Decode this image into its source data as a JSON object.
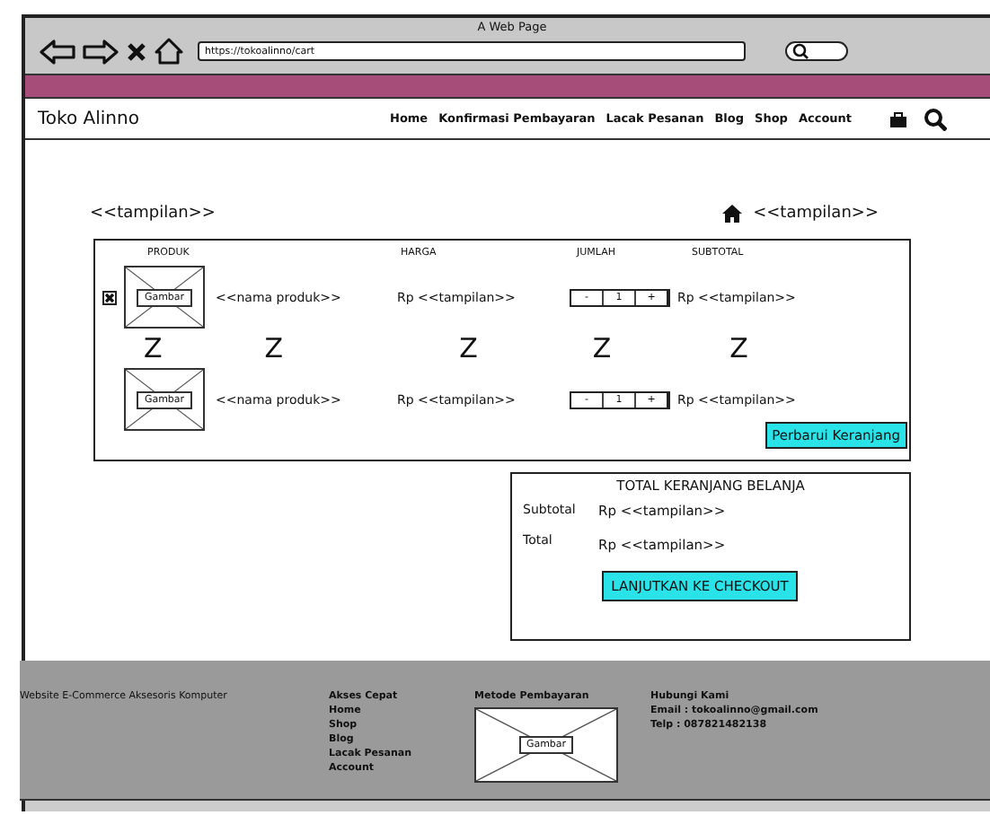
{
  "window": {
    "title": "A Web Page",
    "url": "https://tokoalinno/cart"
  },
  "site": {
    "brand": "Toko Alinno",
    "nav": [
      "Home",
      "Konfirmasi Pembayaran",
      "Lacak Pesanan",
      "Blog",
      "Shop",
      "Account"
    ]
  },
  "page": {
    "heading": "<<tampilan>>",
    "breadcrumb": "<<tampilan>>"
  },
  "cart": {
    "columns": [
      "PRODUK",
      "HARGA",
      "JUMLAH",
      "SUBTOTAL"
    ],
    "rows": [
      {
        "kind": "item",
        "removable": true,
        "image": "Gambar",
        "name": "<<nama produk>>",
        "price": "Rp <<tampilan>>",
        "minus": "-",
        "quantity": "1",
        "plus": "+",
        "subtotal": "Rp <<tampilan>>"
      },
      {
        "kind": "repeat",
        "marks": [
          "Z",
          "Z",
          "Z",
          "Z",
          "Z"
        ]
      },
      {
        "kind": "item",
        "removable": false,
        "image": "Gambar",
        "name": "<<nama produk>>",
        "price": "Rp <<tampilan>>",
        "minus": "-",
        "quantity": "1",
        "plus": "+",
        "subtotal": "Rp <<tampilan>>"
      }
    ],
    "update_button": "Perbarui Keranjang"
  },
  "totals": {
    "title": "TOTAL KERANJANG BELANJA",
    "lines": [
      {
        "label": "Subtotal",
        "value": "Rp <<tampilan>>"
      },
      {
        "label": "Total",
        "value": "Rp <<tampilan>>"
      }
    ],
    "button": "LANJUTKAN KE CHECKOUT"
  },
  "footer": {
    "about": "Website E-Commerce Aksesoris Komputer",
    "links": {
      "title": "Akses Cepat",
      "items": [
        "Home",
        "Shop",
        "Blog",
        "Lacak Pesanan",
        "Account"
      ]
    },
    "payment": {
      "title": "Metode Pembayaran",
      "image": "Gambar"
    },
    "contact": {
      "title": "Hubungi Kami",
      "lines": [
        "Email : tokoalinno@gmail.com",
        "Telp : 087821482138"
      ]
    }
  }
}
